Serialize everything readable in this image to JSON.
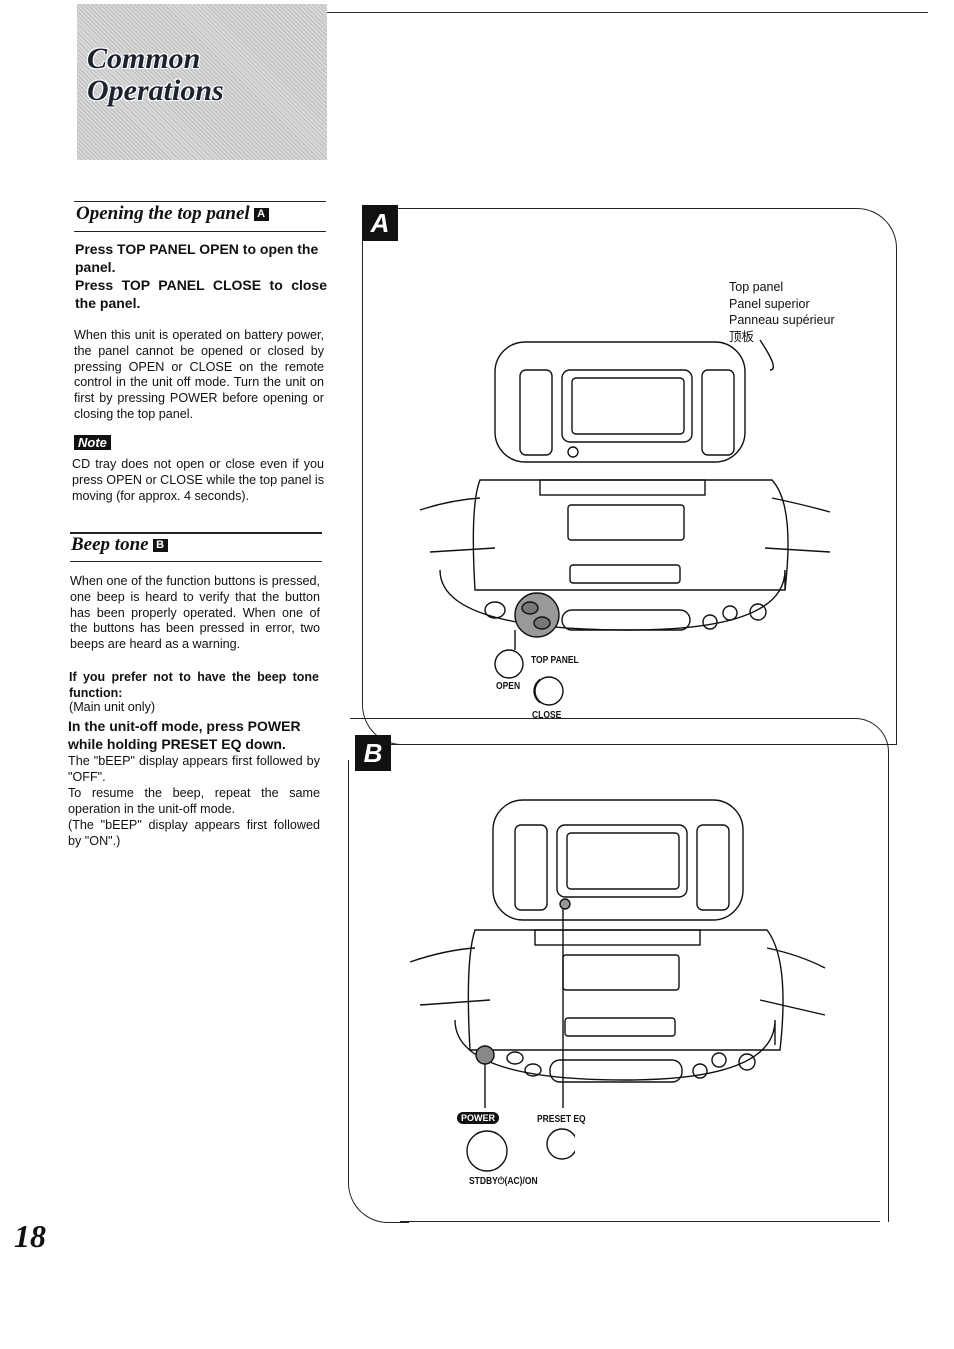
{
  "header": {
    "title_line1": "Common",
    "title_line2": "Operations"
  },
  "sections": {
    "top_panel": {
      "heading": "Opening the top panel",
      "badge": "A",
      "instruction1": "Press TOP PANEL OPEN to open the panel.",
      "instruction2": "Press TOP PANEL CLOSE to close the panel.",
      "body": "When this unit is operated on battery power, the panel cannot be opened or closed by pressing OPEN or CLOSE on the remote control in the unit off mode. Turn the unit on first by pressing POWER before opening or closing the top panel.",
      "note_label": "Note",
      "note_text": "CD tray does not open or close even if you press OPEN or CLOSE while the top panel is moving (for approx. 4 seconds)."
    },
    "beep_tone": {
      "heading": "Beep tone",
      "badge": "B",
      "body": "When one of the function buttons is pressed, one beep is heard to verify that the button has been properly operated. When one of the buttons has been pressed in error, two beeps are heard as a warning.",
      "subheading": "If you prefer not to have the beep tone function:",
      "main_only": "(Main unit only)",
      "instruction": "In the unit-off mode, press POWER while holding PRESET EQ down.",
      "result": "The \"bEEP\" display appears first followed by \"OFF\".",
      "resume": "To resume the beep, repeat the same operation in the unit-off mode.",
      "resume_result": "(The \"bEEP\" display appears first followed by \"ON\".)"
    }
  },
  "figure_a": {
    "label": "A",
    "top_panel_en": "Top panel",
    "top_panel_es": "Panel superior",
    "top_panel_fr": "Panneau supérieur",
    "top_panel_zh": "顶板",
    "button_group": "TOP PANEL",
    "open": "OPEN",
    "close": "CLOSE"
  },
  "figure_b": {
    "label": "B",
    "power": "POWER",
    "preset_eq": "PRESET EQ",
    "stdby": "STDBY⏻(AC)/ON"
  },
  "page_number": "18"
}
